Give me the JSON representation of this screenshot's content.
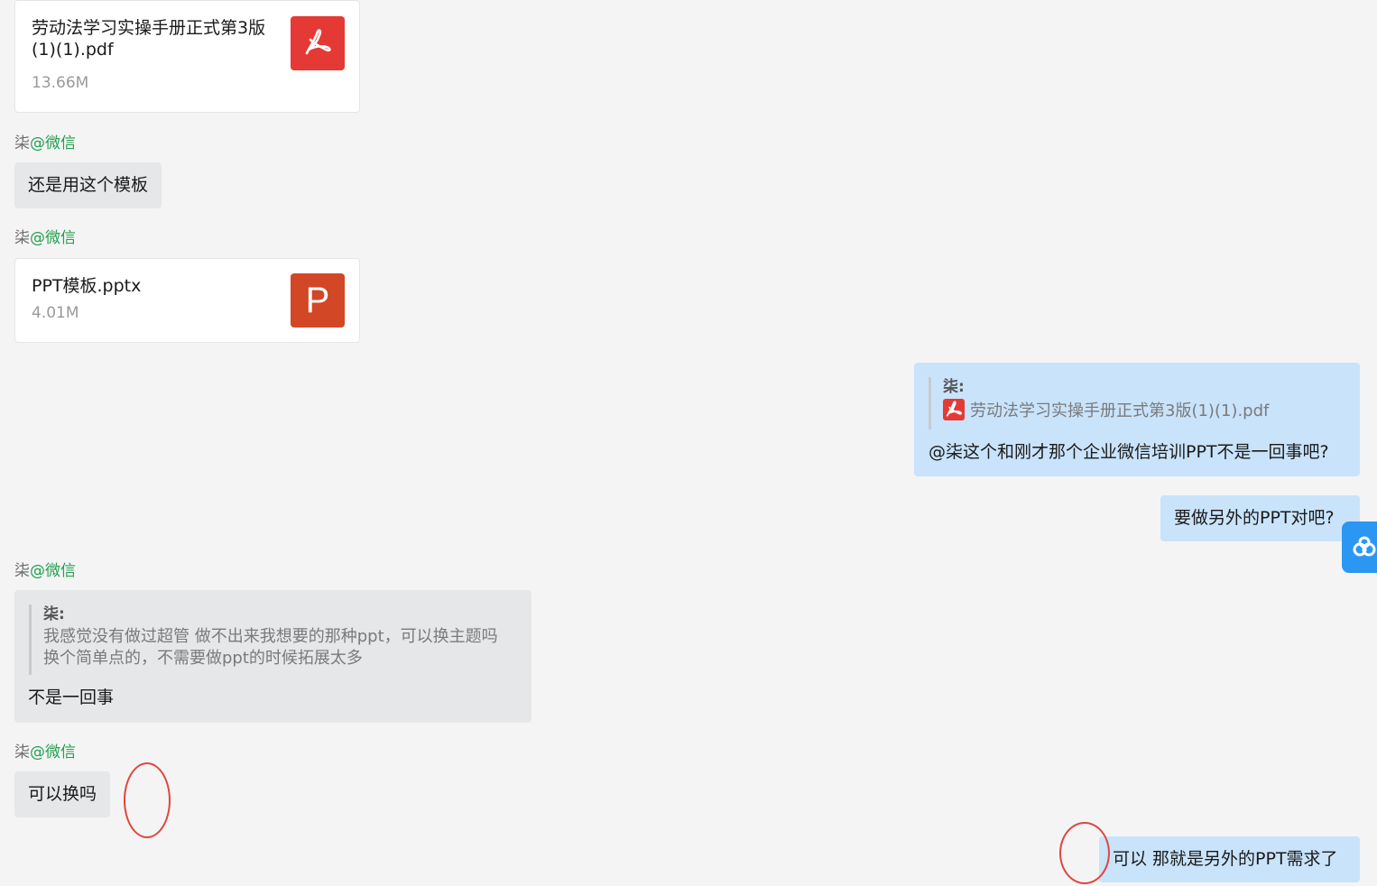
{
  "messages": {
    "file_pdf": {
      "name": "劳动法学习实操手册正式第3版(1)(1).pdf",
      "size": "13.66M",
      "icon": "pdf-icon"
    },
    "sender_1": {
      "name": "柒",
      "tag": "@微信"
    },
    "text_1": "还是用这个模板",
    "sender_2": {
      "name": "柒",
      "tag": "@微信"
    },
    "file_ppt": {
      "name": "PPT模板.pptx",
      "size": "4.01M",
      "icon_letter": "P"
    },
    "reply_out_1": {
      "quote_author": "柒:",
      "quote_file": "劳动法学习实操手册正式第3版(1)(1).pdf",
      "text": "@柒这个和刚才那个企业微信培训PPT不是一回事吧?"
    },
    "text_out_2": "要做另外的PPT对吧?",
    "sender_3": {
      "name": "柒",
      "tag": "@微信"
    },
    "reply_in_1": {
      "quote_author": "柒:",
      "quote_text_line1": "我感觉没有做过超管  做不出来我想要的那种ppt，可以换主题吗",
      "quote_text_line2": "换个简单点的，不需要做ppt的时候拓展太多",
      "text": "不是一回事"
    },
    "sender_4": {
      "name": "柒",
      "tag": "@微信"
    },
    "text_in_3": "可以换吗",
    "text_out_3": "可以 那就是另外的PPT需求了"
  },
  "colors": {
    "background": "#f4f4f5",
    "incoming_bubble": "#e6e7e9",
    "outgoing_bubble": "#c9e3fb",
    "wechat_tag": "#22a04b",
    "pdf_red": "#e53935",
    "ppt_orange": "#d24726",
    "annotation_red": "#e0463e",
    "widget_blue": "#2b97f2"
  }
}
